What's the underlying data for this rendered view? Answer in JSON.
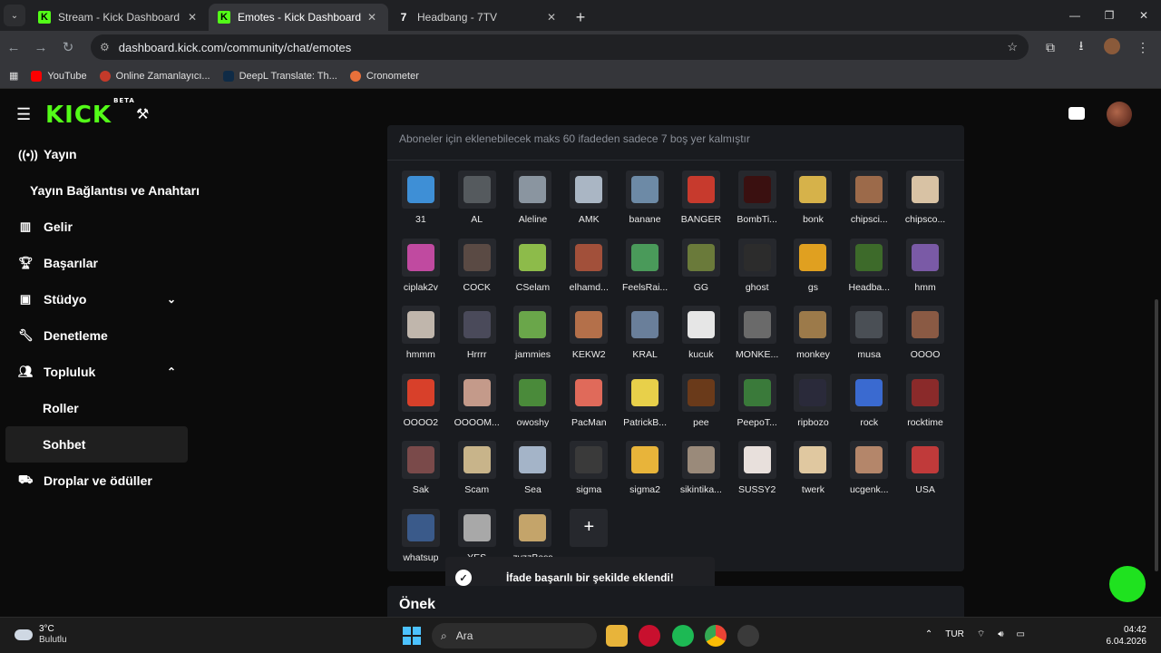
{
  "browser": {
    "tabs": [
      {
        "title": "Stream - Kick Dashboard",
        "icon": "kick-icon",
        "active": false
      },
      {
        "title": "Emotes - Kick Dashboard",
        "icon": "kick-icon",
        "active": true
      },
      {
        "title": "Headbang - 7TV",
        "icon": "7tv-icon",
        "active": false
      }
    ],
    "url": "dashboard.kick.com/community/chat/emotes",
    "bookmarks": [
      "YouTube",
      "Online Zamanlayıcı...",
      "DeepL Translate: Th...",
      "Cronometer"
    ]
  },
  "header": {
    "logo": "KICK",
    "logo_badge": "BETA"
  },
  "sidebar": {
    "items": [
      {
        "label": "Yayın",
        "icon": "broadcast-icon"
      },
      {
        "label": "Yayın Bağlantısı ve Anahtarı",
        "icon": ""
      },
      {
        "label": "Gelir",
        "icon": "chart-icon"
      },
      {
        "label": "Başarılar",
        "icon": "trophy-icon"
      },
      {
        "label": "Stüdyo",
        "icon": "studio-icon"
      },
      {
        "label": "Denetleme",
        "icon": "wrench-icon"
      },
      {
        "label": "Topluluk",
        "icon": "community-icon"
      },
      {
        "label": "Roller",
        "icon": ""
      },
      {
        "label": "Sohbet",
        "icon": ""
      },
      {
        "label": "Droplar ve ödüller",
        "icon": "gift-icon"
      }
    ]
  },
  "emotes_panel": {
    "note": "Aboneler için eklenebilecek maks 60 ifadeden sadece 7 boş yer kalmıştır",
    "emotes": [
      {
        "name": "31",
        "color": "#3e8fd6"
      },
      {
        "name": "AL",
        "color": "#555a5e"
      },
      {
        "name": "Aleline",
        "color": "#8a95a0"
      },
      {
        "name": "AMK",
        "color": "#aab6c4"
      },
      {
        "name": "banane",
        "color": "#6d8aa6"
      },
      {
        "name": "BANGER",
        "color": "#c73a2d"
      },
      {
        "name": "BombTi...",
        "color": "#3a1010"
      },
      {
        "name": "bonk",
        "color": "#d6b24a"
      },
      {
        "name": "chipsci...",
        "color": "#9c6a4a"
      },
      {
        "name": "chipsco...",
        "color": "#d8c2a4"
      },
      {
        "name": "ciplak2v",
        "color": "#c04aa0"
      },
      {
        "name": "COCK",
        "color": "#5a4a44"
      },
      {
        "name": "CSelam",
        "color": "#8dbb4a"
      },
      {
        "name": "elhamd...",
        "color": "#a2503a"
      },
      {
        "name": "FeelsRai...",
        "color": "#4a9a5a"
      },
      {
        "name": "GG",
        "color": "#6a7a3a"
      },
      {
        "name": "ghost",
        "color": "#2c2c2c"
      },
      {
        "name": "gs",
        "color": "#e0a020"
      },
      {
        "name": "Headba...",
        "color": "#3d6a2a"
      },
      {
        "name": "hmm",
        "color": "#7a5aa6"
      },
      {
        "name": "hmmm",
        "color": "#c0b6ac"
      },
      {
        "name": "Hrrrr",
        "color": "#4a4a5a"
      },
      {
        "name": "jammies",
        "color": "#6aa64a"
      },
      {
        "name": "KEKW2",
        "color": "#b4704a"
      },
      {
        "name": "KRAL",
        "color": "#6a7f9a"
      },
      {
        "name": "kucuk",
        "color": "#e6e6e6"
      },
      {
        "name": "MONKE...",
        "color": "#6a6a6a"
      },
      {
        "name": "monkey",
        "color": "#9c7a4a"
      },
      {
        "name": "musa",
        "color": "#4a4f55"
      },
      {
        "name": "OOOO",
        "color": "#8a5a44"
      },
      {
        "name": "OOOO2",
        "color": "#d8402a"
      },
      {
        "name": "OOOOM...",
        "color": "#c49a8a"
      },
      {
        "name": "owoshy",
        "color": "#4a8a3a"
      },
      {
        "name": "PacMan",
        "color": "#e06a5a"
      },
      {
        "name": "PatrickB...",
        "color": "#e8d04a"
      },
      {
        "name": "pee",
        "color": "#6a3a1a"
      },
      {
        "name": "PeepoT...",
        "color": "#3a7a3a"
      },
      {
        "name": "ripbozo",
        "color": "#2a2a3a"
      },
      {
        "name": "rock",
        "color": "#3a6ad0"
      },
      {
        "name": "rocktime",
        "color": "#8a2a2a"
      },
      {
        "name": "Sak",
        "color": "#7a4a4a"
      },
      {
        "name": "Scam",
        "color": "#c8b48a"
      },
      {
        "name": "Sea",
        "color": "#a4b4c8"
      },
      {
        "name": "sigma",
        "color": "#3a3a3a"
      },
      {
        "name": "sigma2",
        "color": "#e8b43a"
      },
      {
        "name": "sikintika...",
        "color": "#9a8a7a"
      },
      {
        "name": "SUSSY2",
        "color": "#e8e0dc"
      },
      {
        "name": "twerk",
        "color": "#e0c8a0"
      },
      {
        "name": "ucgenk...",
        "color": "#b4866a"
      },
      {
        "name": "USA",
        "color": "#c03a3a"
      },
      {
        "name": "whatsup",
        "color": "#3a5a8a"
      },
      {
        "name": "YES",
        "color": "#a8a8a8"
      },
      {
        "name": "zyzzBass",
        "color": "#c4a46a"
      }
    ],
    "add_label": "+"
  },
  "toast": {
    "message": "İfade başarılı bir şekilde eklendi!"
  },
  "preview_section": {
    "title": "Önek"
  },
  "taskbar": {
    "weather_temp": "3°C",
    "weather_desc": "Bulutlu",
    "search_placeholder": "Ara",
    "lang": "TUR",
    "time": "04:42",
    "date": "6.04.2026"
  }
}
